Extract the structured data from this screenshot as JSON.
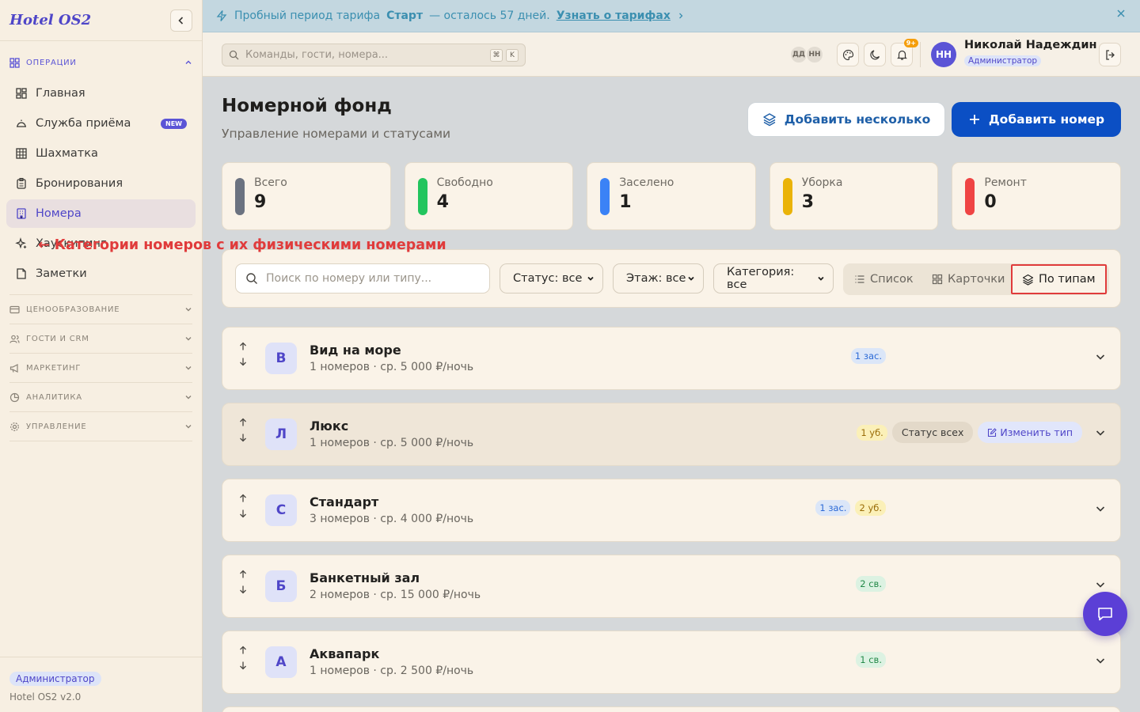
{
  "app": {
    "title": "Hotel OS2",
    "version": "Hotel OS2 v2.0",
    "role": "Администратор"
  },
  "banner": {
    "prefix": "Пробный период тарифа",
    "plan": "Старт",
    "suffix": "— осталось 57 дней.",
    "link": "Узнать о тарифах"
  },
  "sidebar": {
    "sections": [
      {
        "label": "ОПЕРАЦИИ",
        "icon": "grid-icon",
        "open": true
      },
      {
        "label": "ЦЕНООБРАЗОВАНИЕ",
        "icon": "card-icon"
      },
      {
        "label": "ГОСТИ И CRM",
        "icon": "users-icon"
      },
      {
        "label": "МАРКЕТИНГ",
        "icon": "megaphone-icon"
      },
      {
        "label": "АНАЛИТИКА",
        "icon": "pie-icon"
      },
      {
        "label": "УПРАВЛЕНИЕ",
        "icon": "gear-icon"
      }
    ],
    "items": [
      {
        "label": "Главная",
        "icon": "dashboard-icon"
      },
      {
        "label": "Служба приёма",
        "icon": "bell-desk-icon",
        "badge": "NEW"
      },
      {
        "label": "Шахматка",
        "icon": "table-icon"
      },
      {
        "label": "Бронирования",
        "icon": "clipboard-icon"
      },
      {
        "label": "Номера",
        "icon": "building-icon",
        "active": true
      },
      {
        "label": "Хаускипинг",
        "icon": "sparkle-icon"
      },
      {
        "label": "Заметки",
        "icon": "note-icon"
      }
    ]
  },
  "header": {
    "search_placeholder": "Команды, гости, номера...",
    "kbd": [
      "⌘",
      "K"
    ],
    "presence": [
      "ДД",
      "НН"
    ],
    "notif_count": "9+",
    "user": {
      "initials": "НН",
      "name": "Николай Надеждин",
      "role": "Администратор"
    }
  },
  "page": {
    "title": "Номерной фонд",
    "subtitle": "Управление номерами и статусами",
    "btn_multi": "Добавить несколько",
    "btn_add": "Добавить номер"
  },
  "stats": [
    {
      "label": "Всего",
      "value": "9",
      "color": "#6b7280"
    },
    {
      "label": "Свободно",
      "value": "4",
      "color": "#22c55e"
    },
    {
      "label": "Заселено",
      "value": "1",
      "color": "#3b82f6"
    },
    {
      "label": "Уборка",
      "value": "3",
      "color": "#eab308"
    },
    {
      "label": "Ремонт",
      "value": "0",
      "color": "#ef4444"
    }
  ],
  "annotation": "← Категории номеров с их физическими номерами",
  "filters": {
    "search_placeholder": "Поиск по номеру или типу...",
    "status": "Статус: все",
    "floor": "Этаж: все",
    "category": "Категория: все",
    "views": [
      "Список",
      "Карточки",
      "По типам"
    ]
  },
  "types": [
    {
      "letter": "В",
      "name": "Вид на море",
      "meta": "1 номеров · ср. 5 000 ₽/ночь",
      "pills": [
        {
          "text": "1 зас.",
          "kind": "blue"
        }
      ]
    },
    {
      "letter": "Л",
      "name": "Люкс",
      "meta": "1 номеров · ср. 5 000 ₽/ночь",
      "pills": [
        {
          "text": "1 уб.",
          "kind": "yellow"
        }
      ],
      "status_all": "Статус всех",
      "edit_type": "Изменить тип"
    },
    {
      "letter": "С",
      "name": "Стандарт",
      "meta": "3 номеров · ср. 4 000 ₽/ночь",
      "pills": [
        {
          "text": "1 зас.",
          "kind": "blue"
        },
        {
          "text": "2 уб.",
          "kind": "yellow"
        }
      ]
    },
    {
      "letter": "Б",
      "name": "Банкетный зал",
      "meta": "2 номеров · ср. 15 000 ₽/ночь",
      "pills": [
        {
          "text": "2 св.",
          "kind": "green"
        }
      ]
    },
    {
      "letter": "А",
      "name": "Аквапарк",
      "meta": "1 номеров · ср. 2 500 ₽/ночь",
      "pills": [
        {
          "text": "1 св.",
          "kind": "green"
        }
      ]
    }
  ]
}
